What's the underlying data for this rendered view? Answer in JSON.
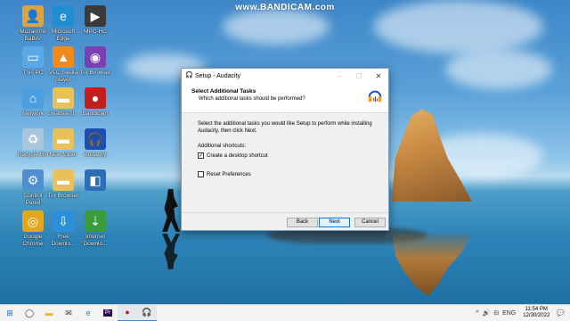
{
  "watermark": "www.BANDICAM.com",
  "desktop_icons": [
    {
      "id": "muzammil",
      "label": "Muzammil\nBaBAr",
      "icon": "user-folder-icon",
      "color": "#d9a441"
    },
    {
      "id": "edge1",
      "label": "Microsoft\nEdge",
      "icon": "edge-icon",
      "color": "#1f8fd1"
    },
    {
      "id": "mpchc",
      "label": "MPC-HC",
      "icon": "mpc-hc-icon",
      "color": "#3a3a3a"
    },
    {
      "id": "thispc",
      "label": "This PC",
      "icon": "computer-icon",
      "color": "#5aa9e6"
    },
    {
      "id": "vlc",
      "label": "VLC media\nplayer",
      "icon": "vlc-icon",
      "color": "#f08a1c"
    },
    {
      "id": "torbrowser1",
      "label": "Tor Browser",
      "icon": "tor-icon",
      "color": "#7b3fb2"
    },
    {
      "id": "network",
      "label": "Network",
      "icon": "network-icon",
      "color": "#4c9ee0"
    },
    {
      "id": "creative",
      "label": "creative-st...",
      "icon": "folder-icon",
      "color": "#e8c15b"
    },
    {
      "id": "bandicam",
      "label": "Bandicam",
      "icon": "bandicam-icon",
      "color": "#c21e1e"
    },
    {
      "id": "recycle",
      "label": "Recycle Bin",
      "icon": "recycle-bin-icon",
      "color": "#a9c7dc"
    },
    {
      "id": "newfolder",
      "label": "New folder",
      "icon": "folder-icon",
      "color": "#e8c15b"
    },
    {
      "id": "audacity",
      "label": "Audacity",
      "icon": "audacity-icon",
      "color": "#1d4fb3"
    },
    {
      "id": "controlpanel",
      "label": "Control\nPanel",
      "icon": "control-panel-icon",
      "color": "#4f8fcf"
    },
    {
      "id": "torbrowser2",
      "label": "Tor Browser",
      "icon": "folder-icon",
      "color": "#e8c15b"
    },
    {
      "id": "ssc",
      "label": "",
      "icon": "app-icon",
      "color": "#2c6fb7"
    },
    {
      "id": "chrome",
      "label": "Google\nChrome",
      "icon": "chrome-icon",
      "color": "#e4a61c"
    },
    {
      "id": "freedownload",
      "label": "Free\nDownlo...",
      "icon": "download-icon",
      "color": "#2b8fd9"
    },
    {
      "id": "idm",
      "label": "Internet\nDownlo...",
      "icon": "idm-icon",
      "color": "#3a9d3a"
    }
  ],
  "dialog": {
    "title": "Setup - Audacity",
    "minimize": "–",
    "maximize": "☐",
    "close": "✕",
    "heading": "Select Additional Tasks",
    "subheading": "Which additional tasks should be performed?",
    "description": "Select the additional tasks you would like Setup to perform while installing Audacity, then click Next.",
    "section_label": "Additional shortcuts:",
    "checkboxes": [
      {
        "label": "Create a desktop shortcut",
        "checked": true
      },
      {
        "label": "Reset Preferences",
        "checked": false
      }
    ],
    "buttons": {
      "back": "Back",
      "next": "Next",
      "cancel": "Cancel"
    }
  },
  "taskbar": {
    "items": [
      {
        "name": "start-icon",
        "glyph": "⊞",
        "color": "#1a6fc9"
      },
      {
        "name": "search-icon",
        "glyph": "◯",
        "color": "#333"
      },
      {
        "name": "file-explorer-icon",
        "glyph": "▬",
        "color": "#e3b53c"
      },
      {
        "name": "mail-icon",
        "glyph": "✉",
        "color": "#333"
      },
      {
        "name": "edge-icon",
        "glyph": "e",
        "color": "#1f8fd1"
      },
      {
        "name": "premiere-icon",
        "glyph": "Pr",
        "color": "#4b1f7a"
      },
      {
        "name": "bandicam-icon",
        "glyph": "●",
        "color": "#c21e1e"
      },
      {
        "name": "audacity-icon",
        "glyph": "🎧",
        "color": "#1d4fb3"
      }
    ],
    "tray": {
      "up": "^",
      "speaker": "🔊",
      "network": "⊟",
      "lang": "ENG",
      "notif": "💬"
    },
    "time": "11:54 PM",
    "date": "12/30/2022"
  }
}
